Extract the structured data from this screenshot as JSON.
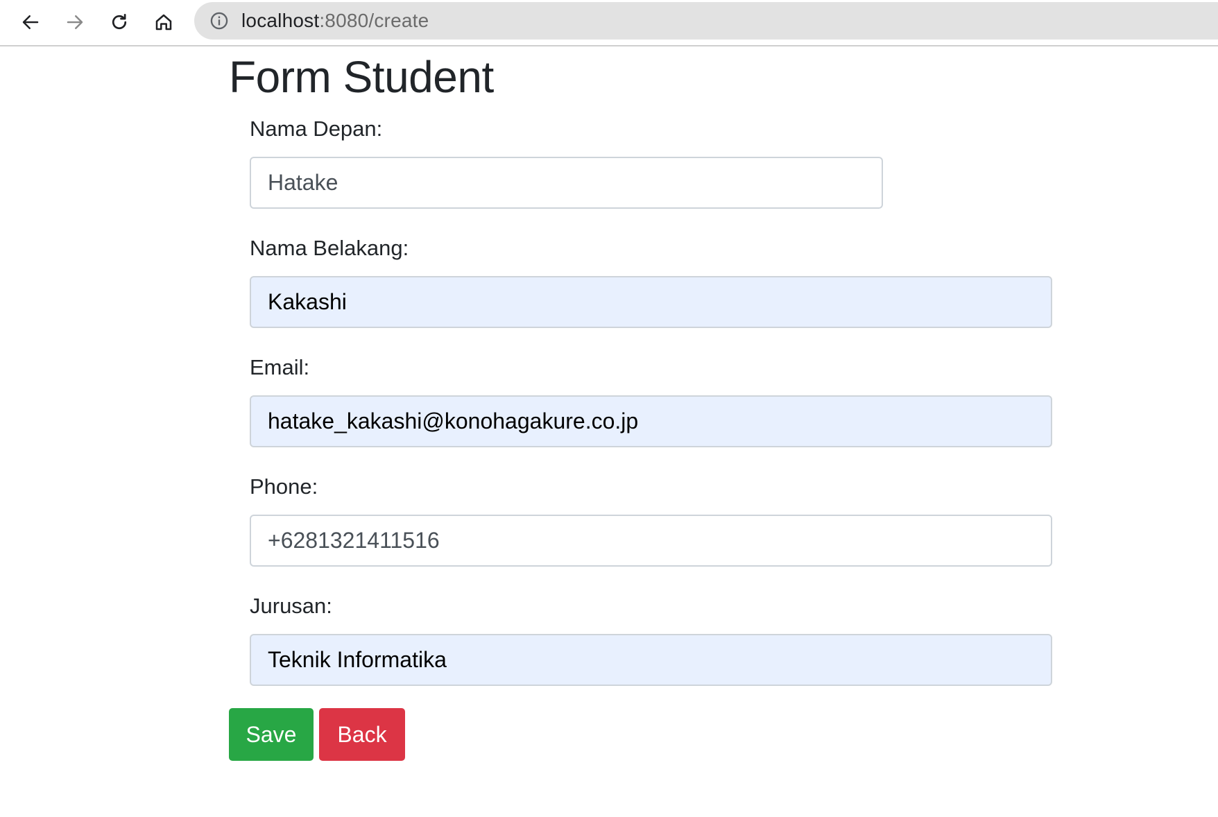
{
  "browser": {
    "url_host": "localhost",
    "url_path": ":8080/create",
    "icons": [
      "back-arrow-icon",
      "forward-arrow-icon",
      "reload-icon",
      "home-icon",
      "info-icon"
    ]
  },
  "page": {
    "title": "Form Student"
  },
  "form": {
    "first_name": {
      "label": "Nama Depan:",
      "value": "Hatake"
    },
    "last_name": {
      "label": "Nama Belakang:",
      "value": "Kakashi"
    },
    "email": {
      "label": "Email:",
      "value": "hatake_kakashi@konohagakure.co.jp"
    },
    "phone": {
      "label": "Phone:",
      "value": "+6281321411516"
    },
    "major": {
      "label": "Jurusan:",
      "value": "Teknik Informatika"
    }
  },
  "actions": {
    "save_label": "Save",
    "back_label": "Back"
  },
  "colors": {
    "save": "#28a745",
    "back": "#dc3545",
    "autofill": "#e8f0fe"
  }
}
